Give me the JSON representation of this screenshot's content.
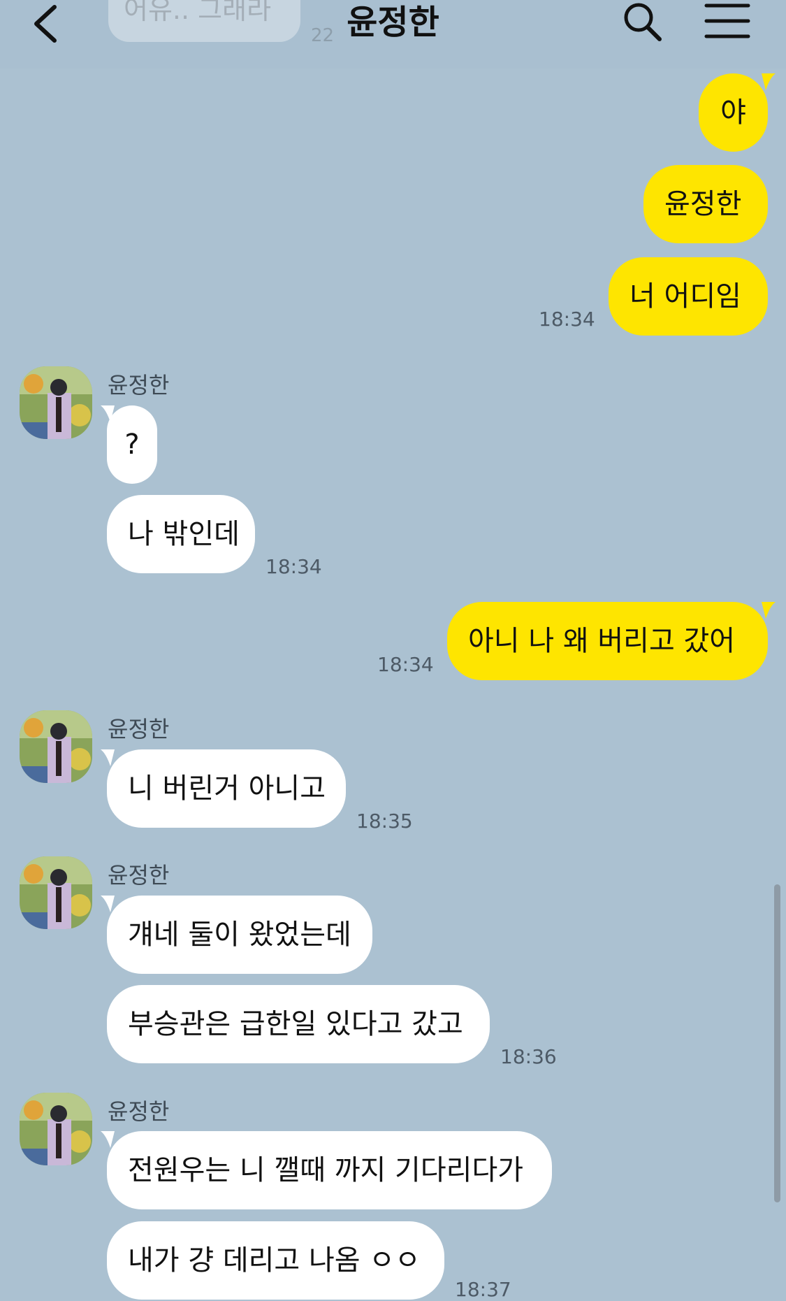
{
  "header": {
    "title": "윤정한",
    "ghost_text": "어유.. 그래라",
    "ghost_time": "22"
  },
  "colors": {
    "background": "#abc1d1",
    "my_bubble": "#fee500",
    "their_bubble": "#ffffff"
  },
  "icons": [
    "back-icon",
    "search-icon",
    "menu-icon"
  ],
  "messages": {
    "m1": {
      "text": "야"
    },
    "m2": {
      "text": "윤정한"
    },
    "m3": {
      "text": "너 어디임",
      "time": "18:34"
    },
    "g1": {
      "sender": "윤정한"
    },
    "m4": {
      "text": "?"
    },
    "m5": {
      "text": "나 밖인데",
      "time": "18:34"
    },
    "m6": {
      "text": "아니 나 왜 버리고 갔어",
      "time": "18:34"
    },
    "g2": {
      "sender": "윤정한"
    },
    "m7": {
      "text": "니 버린거 아니고",
      "time": "18:35"
    },
    "g3": {
      "sender": "윤정한"
    },
    "m8": {
      "text": "걔네 둘이 왔었는데"
    },
    "m9": {
      "text": "부승관은 급한일 있다고 갔고",
      "time": "18:36"
    },
    "g4": {
      "sender": "윤정한"
    },
    "m10": {
      "text": "전원우는 니 깰때 까지 기다리다가"
    },
    "m11": {
      "text": "내가 걍 데리고 나옴 ㅇㅇ",
      "time": "18:37"
    }
  }
}
